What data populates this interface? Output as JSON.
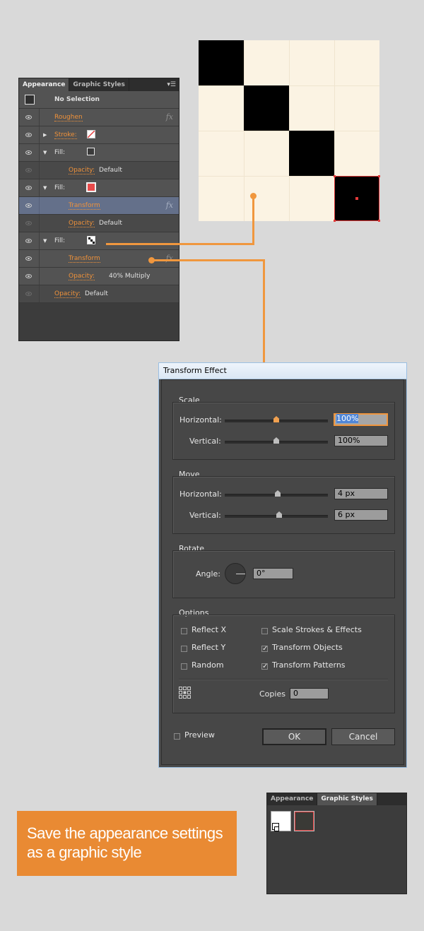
{
  "appearance_panel": {
    "tabs": [
      "Appearance",
      "Graphic Styles"
    ],
    "menu_icon": "panel-menu-icon",
    "header": "No Selection",
    "rows": [
      {
        "label": "Roughen",
        "type": "effect",
        "fx": "fx"
      },
      {
        "label": "Stroke:",
        "type": "stroke"
      },
      {
        "label": "Fill:",
        "type": "fill-white"
      },
      {
        "label": "Opacity:",
        "value": "Default",
        "type": "opacity"
      },
      {
        "label": "Fill:",
        "type": "fill-red"
      },
      {
        "label": "Transform",
        "type": "effect-selected",
        "fx": "fx"
      },
      {
        "label": "Opacity:",
        "value": "Default",
        "type": "opacity"
      },
      {
        "label": "Fill:",
        "type": "fill-pattern"
      },
      {
        "label": "Transform",
        "type": "effect",
        "fx": "fx"
      },
      {
        "label": "Opacity:",
        "value": "40% Multiply",
        "type": "opacity"
      },
      {
        "label": "Opacity:",
        "value": "Default",
        "type": "opacity-top"
      }
    ],
    "colors": {
      "link": "#f0923a",
      "fill_red": "#e84a4a"
    }
  },
  "dialog": {
    "title": "Transform Effect",
    "scale": {
      "title": "Scale",
      "horizontal_label": "Horizontal:",
      "horizontal_value": "100%",
      "vertical_label": "Vertical:",
      "vertical_value": "100%"
    },
    "move": {
      "title": "Move",
      "horizontal_label": "Horizontal:",
      "horizontal_value": "4 px",
      "vertical_label": "Vertical:",
      "vertical_value": "6 px"
    },
    "rotate": {
      "title": "Rotate",
      "angle_label": "Angle:",
      "angle_value": "0°"
    },
    "options": {
      "title": "Options",
      "reflect_x": "Reflect X",
      "reflect_y": "Reflect Y",
      "random": "Random",
      "scale_strokes": "Scale Strokes & Effects",
      "transform_objects": "Transform Objects",
      "transform_patterns": "Transform Patterns",
      "copies_label": "Copies",
      "copies_value": "0"
    },
    "preview_label": "Preview",
    "ok_label": "OK",
    "cancel_label": "Cancel",
    "checks": {
      "reflect_x": false,
      "reflect_y": false,
      "random": false,
      "scale_strokes": false,
      "transform_objects": true,
      "transform_patterns": true,
      "preview": false
    }
  },
  "callout": {
    "text": "Save the appearance settings as a graphic style",
    "color": "#e98a33"
  },
  "graphic_styles_panel": {
    "tabs": [
      "Appearance",
      "Graphic Styles"
    ]
  }
}
